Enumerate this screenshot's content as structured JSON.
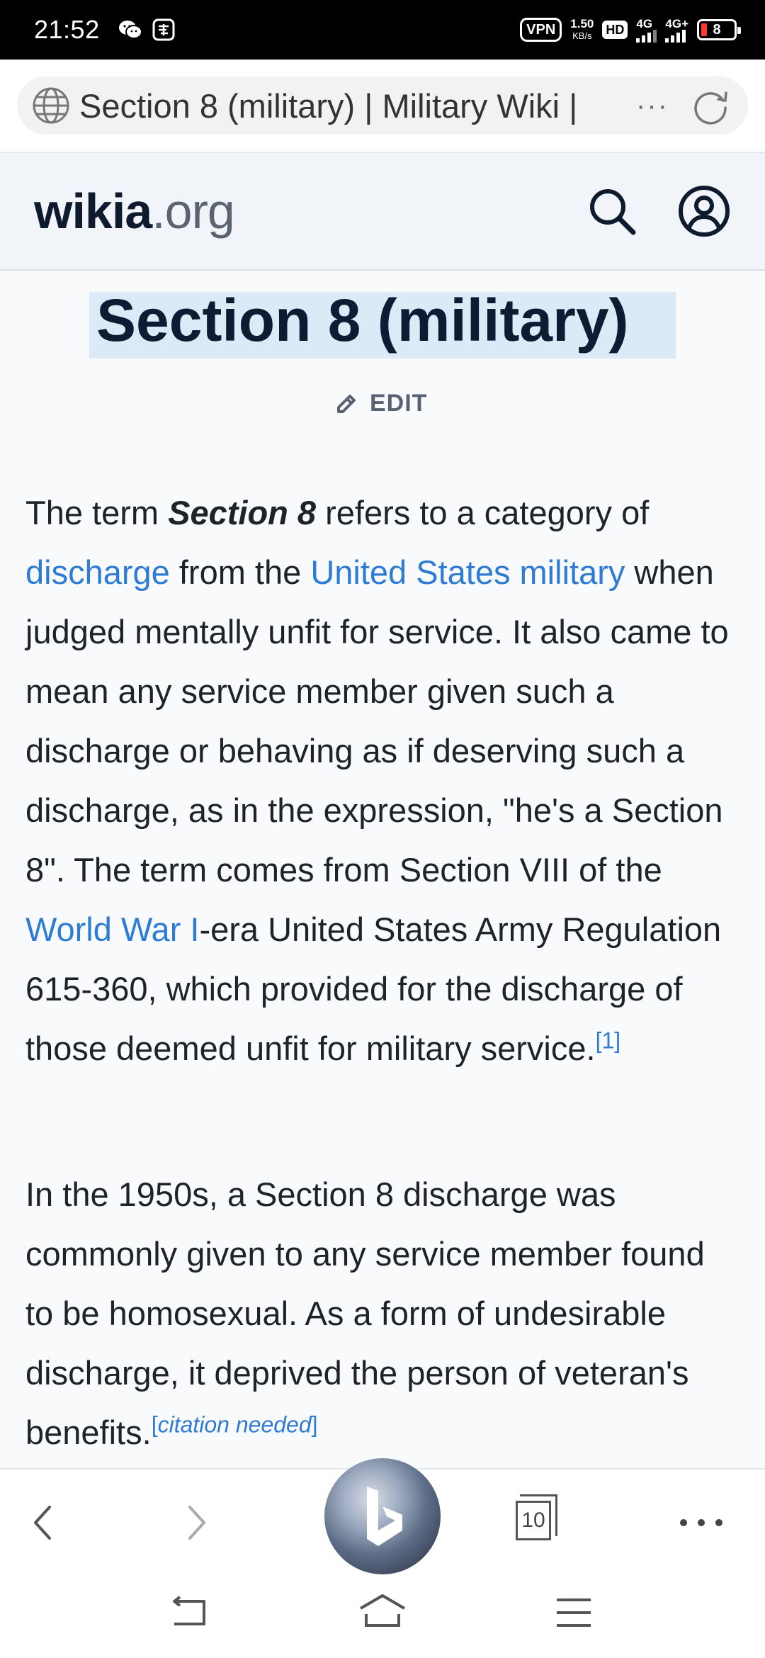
{
  "status_bar": {
    "time": "21:52",
    "vpn": "VPN",
    "speed_value": "1.50",
    "speed_unit": "KB/s",
    "hd": "HD",
    "net1": "4G",
    "net2": "4G+",
    "battery": "8"
  },
  "address_bar": {
    "url_title": "Section 8 (military) | Military Wiki |",
    "more": "···"
  },
  "wiki_header": {
    "logo_main": "wikia",
    "logo_tld": ".org"
  },
  "article": {
    "title": "Section 8 (military)",
    "edit_label": "EDIT",
    "p1": {
      "t1": "The term ",
      "bold_term": "Section 8",
      "t2": " refers to a category of ",
      "link_discharge": "discharge",
      "t3": " from the ",
      "link_usmil": "United States military",
      "t4": " when judged mentally unfit for service. It also came to mean any service member given such a discharge or behaving as if deserving such a discharge, as in the expression, \"he's a Section 8\". The term comes from Section VIII of the ",
      "link_ww1": "World War I",
      "t5": "-era United States Army Regulation 615-360, which provided for the discharge of those deemed unfit for military service.",
      "ref1": "[1]"
    },
    "p2": {
      "text": "In the 1950s, a Section 8 discharge was commonly given to any service member found to be homosexual. As a form of undesirable discharge, it deprived the person of veteran's benefits.",
      "ref_open": "[",
      "citation": "citation needed",
      "ref_close": "]"
    }
  },
  "toolbar": {
    "tabs_count": "10"
  },
  "colors": {
    "link": "#2e7bd6",
    "title_highlight": "#dce9f7",
    "header_bg": "#f1f4f8"
  },
  "icons": [
    "wechat-icon",
    "message-icon",
    "globe-icon",
    "reload-icon",
    "search-icon",
    "account-icon",
    "pencil-icon",
    "back-icon",
    "forward-icon",
    "bing-icon",
    "tabs-icon",
    "more-icon",
    "nav-back-icon",
    "nav-home-icon",
    "nav-menu-icon"
  ]
}
